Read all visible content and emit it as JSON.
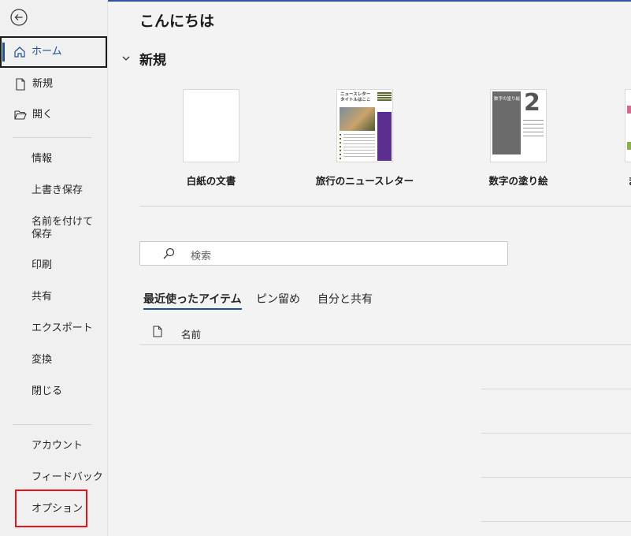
{
  "sidebar": {
    "home": "ホーム",
    "new": "新規",
    "open": "開く",
    "info": "情報",
    "save": "上書き保存",
    "save_as": "名前を付けて保存",
    "print": "印刷",
    "share": "共有",
    "export": "エクスポート",
    "transform": "変換",
    "close": "閉じる",
    "account": "アカウント",
    "feedback": "フィードバック",
    "options": "オプション"
  },
  "main": {
    "greeting": "こんにちは",
    "new_section": "新規",
    "templates": [
      {
        "label": "白紙の文書"
      },
      {
        "label": "旅行のニュースレター",
        "thumb_title": "ニュースレター タイトルはここ"
      },
      {
        "label": "数字の塗り絵",
        "thumb_title": "数字の塗り絵",
        "thumb_number": "2"
      }
    ],
    "partial_template_label": "ま",
    "search_placeholder": "検索",
    "tabs": [
      "最近使ったアイテム",
      "ピン留め",
      "自分と共有"
    ],
    "column_name": "名前"
  },
  "colors": {
    "accent": "#1d4f91",
    "highlight_box": "#e8141b"
  }
}
